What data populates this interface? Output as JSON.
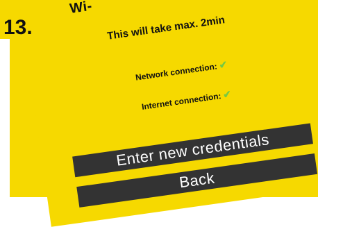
{
  "step_number": "13.",
  "title_partial": "Wi‑",
  "hint_text": "This will take max. 2min",
  "checks": [
    {
      "label": "Network connection:",
      "status_icon": "check-icon",
      "color": "#74c944"
    },
    {
      "label": "Internet connection:",
      "status_icon": "check-icon",
      "color": "#74c944"
    }
  ],
  "buttons": {
    "primary": "Enter new credentials",
    "secondary": "Back"
  },
  "colors": {
    "accent_yellow": "#f6d900",
    "button_dark": "#333333",
    "check_green": "#74c944"
  }
}
